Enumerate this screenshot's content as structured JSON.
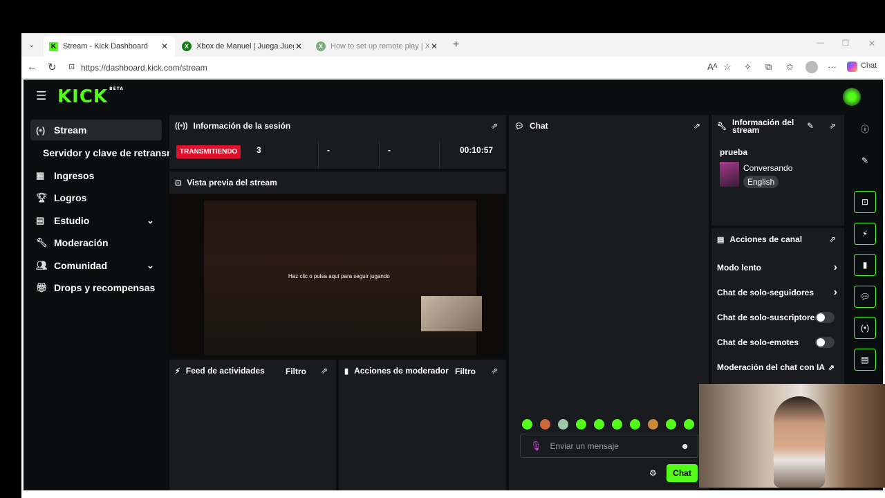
{
  "browser": {
    "tabs": [
      {
        "title": "Stream - Kick Dashboard",
        "favicon": "kick-icon"
      },
      {
        "title": "Xbox de Manuel | Juega Juego ren",
        "favicon": "xbox-icon"
      },
      {
        "title": "How to set up remote play | Xbox",
        "favicon": "xbox-icon"
      }
    ],
    "url": "https://dashboard.kick.com/stream",
    "chat_label": "Chat"
  },
  "app": {
    "logo": "KICK",
    "logo_badge": "BETA",
    "accent": "#53fc18",
    "sidebar": [
      {
        "label": "Stream",
        "icon": "broadcast-icon"
      },
      {
        "label": "Servidor y clave de retransm",
        "icon": ""
      },
      {
        "label": "Ingresos",
        "icon": "chart-icon"
      },
      {
        "label": "Logros",
        "icon": "trophy-icon"
      },
      {
        "label": "Estudio",
        "icon": "layout-icon"
      },
      {
        "label": "Moderación",
        "icon": "wrench-icon"
      },
      {
        "label": "Comunidad",
        "icon": "people-icon"
      },
      {
        "label": "Drops y recompensas",
        "icon": "gift-icon"
      }
    ],
    "session": {
      "title": "Información de la sesión",
      "status": "TRANSMITIENDO",
      "viewers": "3",
      "followers": "-",
      "subs": "-",
      "time": "00:10:57"
    },
    "preview": {
      "title": "Vista previa del stream",
      "overlay_text": "Haz clic o pulsa aquí para seguir jugando"
    },
    "feed": {
      "title": "Feed de actividades",
      "filter": "Filtro"
    },
    "modactions": {
      "title": "Acciones de moderador",
      "filter": "Filtro"
    },
    "chat": {
      "title": "Chat",
      "placeholder": "Enviar un mensaje",
      "send": "Chat"
    },
    "streaminfo": {
      "title": "Información del stream",
      "stream_title": "prueba",
      "category": "Conversando",
      "language": "English"
    },
    "channel": {
      "title": "Acciones de canal",
      "items": [
        {
          "label": "Modo lento"
        },
        {
          "label": "Chat de solo-seguidores"
        },
        {
          "label": "Chat de solo-suscriptores"
        },
        {
          "label": "Chat de solo-emotes"
        },
        {
          "label": "Moderación del chat con IA"
        }
      ]
    }
  }
}
